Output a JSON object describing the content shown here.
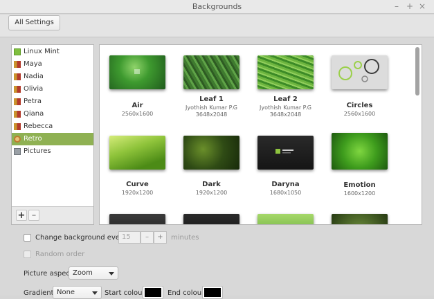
{
  "window": {
    "title": "Backgrounds",
    "controls": {
      "minimize": "–",
      "maximize": "+",
      "close": "×"
    }
  },
  "header": {
    "all_settings_label": "All Settings"
  },
  "sidebar": {
    "items": [
      {
        "label": "Linux Mint",
        "icon": "mint-icon"
      },
      {
        "label": "Maya",
        "icon": "book-icon"
      },
      {
        "label": "Nadia",
        "icon": "book-icon"
      },
      {
        "label": "Olivia",
        "icon": "book-icon"
      },
      {
        "label": "Petra",
        "icon": "book-icon"
      },
      {
        "label": "Qiana",
        "icon": "book-icon"
      },
      {
        "label": "Rebecca",
        "icon": "book-icon"
      },
      {
        "label": "Retro",
        "icon": "retro-icon",
        "selected": true
      },
      {
        "label": "Pictures",
        "icon": "folder-icon"
      }
    ],
    "add_label": "+",
    "remove_label": "–"
  },
  "gallery": {
    "tiles": [
      {
        "name": "Air",
        "author": "",
        "size": "2560x1600"
      },
      {
        "name": "Leaf 1",
        "author": "Jyothish Kumar P.G",
        "size": "3648x2048"
      },
      {
        "name": "Leaf 2",
        "author": "Jyothish Kumar P.G",
        "size": "3648x2048"
      },
      {
        "name": "Circles",
        "author": "",
        "size": "2560x1600"
      },
      {
        "name": "Curve",
        "author": "",
        "size": "1920x1200"
      },
      {
        "name": "Dark",
        "author": "",
        "size": "1920x1200"
      },
      {
        "name": "Daryna",
        "author": "",
        "size": "1680x1050"
      },
      {
        "name": "Emotion",
        "author": "",
        "size": "1600x1200"
      }
    ]
  },
  "controls": {
    "change_background_label": "Change background every",
    "interval_value": "15",
    "minus_label": "–",
    "plus_label": "+",
    "minutes_label": "minutes",
    "random_order_label": "Random order",
    "picture_aspect_label": "Picture aspect",
    "picture_aspect_value": "Zoom",
    "gradient_label": "Gradient",
    "gradient_value": "None",
    "start_colour_label": "Start colour",
    "end_colour_label": "End colour",
    "start_colour": "#000000",
    "end_colour": "#000000"
  },
  "colors": {
    "selection": "#8fb153"
  }
}
